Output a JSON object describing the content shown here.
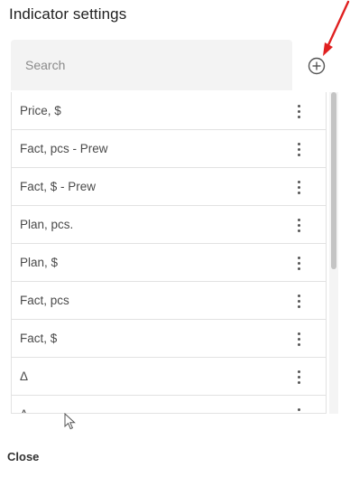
{
  "dialog": {
    "title": "Indicator settings",
    "close_label": "Close"
  },
  "search": {
    "placeholder": "Search",
    "value": ""
  },
  "icons": {
    "add": "plus-circle-icon",
    "item_menu": "vertical-dots-icon",
    "annotation": "red-arrow-icon",
    "cursor": "mouse-pointer-icon"
  },
  "colors": {
    "annotation_arrow": "#e02020",
    "search_background": "#f3f3f3"
  },
  "list": {
    "items": [
      {
        "label": "Price, $"
      },
      {
        "label": "Fact, pcs - Prew"
      },
      {
        "label": "Fact, $ - Prew"
      },
      {
        "label": "Plan, pcs."
      },
      {
        "label": "Plan, $"
      },
      {
        "label": "Fact, pcs"
      },
      {
        "label": "Fact, $"
      },
      {
        "label": "Δ"
      },
      {
        "label": "Δ"
      }
    ],
    "scroll": {
      "visible_fraction": 0.55,
      "position_fraction": 0.0
    }
  }
}
